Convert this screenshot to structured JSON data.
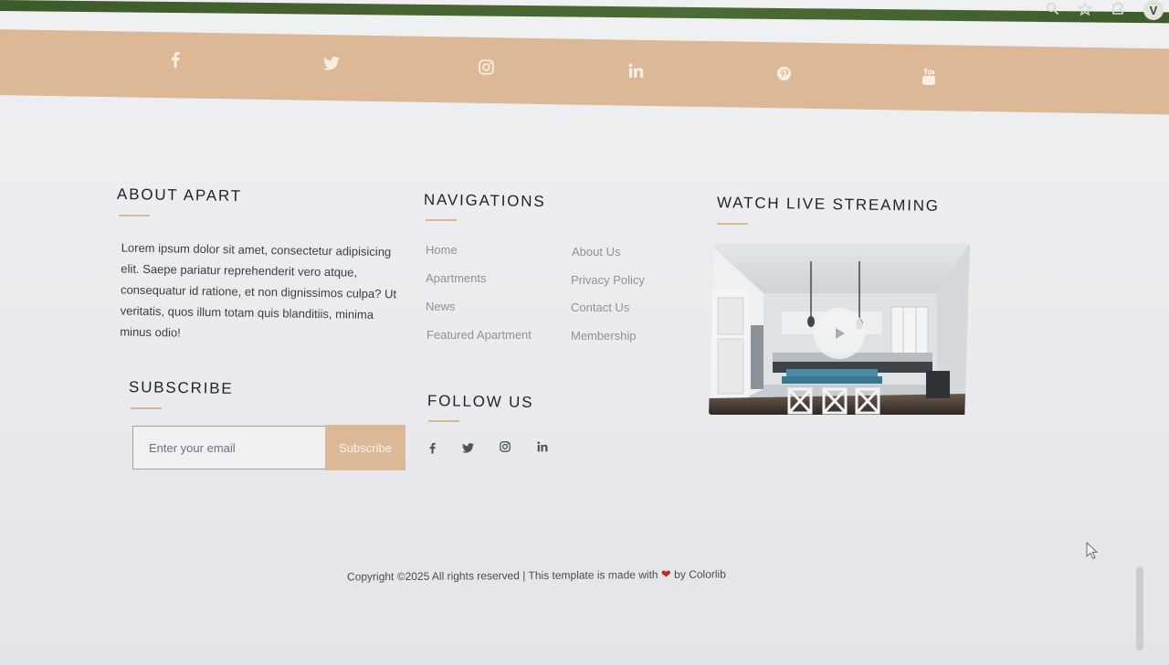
{
  "browser": {
    "profile_initial": "V",
    "icons": [
      "zoom-icon",
      "star-icon",
      "extensions-icon"
    ]
  },
  "social_band": {
    "color": "#dcb896",
    "icons": [
      "facebook-icon",
      "twitter-icon",
      "instagram-icon",
      "linkedin-icon",
      "pinterest-icon",
      "youtube-icon"
    ]
  },
  "about": {
    "title": "ABOUT APART",
    "text": "Lorem ipsum dolor sit amet, consectetur adipisicing elit. Saepe pariatur reprehenderit vero atque, consequatur id ratione, et non dignissimos culpa? Ut veritatis, quos illum totam quis blanditiis, minima minus odio!"
  },
  "navigations": {
    "title": "NAVIGATIONS",
    "col1": [
      "Home",
      "Apartments",
      "News",
      "Featured Apartment"
    ],
    "col2": [
      "About Us",
      "Privacy Policy",
      "Contact Us",
      "Membership"
    ]
  },
  "streaming": {
    "title": "WATCH LIVE STREAMING"
  },
  "subscribe": {
    "title": "SUBSCRIBE",
    "placeholder": "Enter your email",
    "button": "Subscribe"
  },
  "follow": {
    "title": "FOLLOW US",
    "icons": [
      "facebook-icon",
      "twitter-icon",
      "instagram-icon",
      "linkedin-icon"
    ]
  },
  "footer": {
    "copyright_pre": "Copyright ©2025 All rights reserved | This template is made with",
    "heart": "❤",
    "copyright_post": "by Colorlib"
  },
  "colors": {
    "accent": "#dcb896",
    "heading": "#1f2327",
    "link": "#8e9297"
  }
}
